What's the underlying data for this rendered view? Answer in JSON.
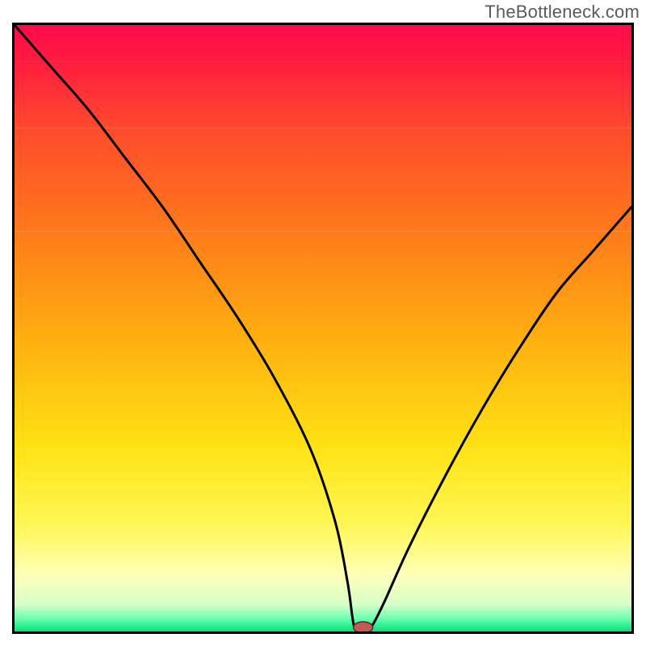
{
  "watermark": "TheBottleneck.com",
  "chart_data": {
    "type": "line",
    "title": "",
    "xlabel": "",
    "ylabel": "",
    "xlim": [
      0,
      100
    ],
    "ylim": [
      0,
      100
    ],
    "x": [
      0,
      6,
      12,
      18,
      24,
      30,
      36,
      42,
      48,
      52,
      54,
      55,
      56,
      57,
      58,
      60,
      64,
      70,
      76,
      82,
      88,
      94,
      100
    ],
    "values": [
      100,
      93,
      86,
      78,
      70,
      61,
      52,
      42,
      30,
      18,
      8,
      1,
      0,
      0,
      1,
      5,
      14,
      26,
      37,
      47,
      56,
      63,
      70
    ],
    "marker": {
      "x": 56.5,
      "y": 0
    },
    "gradient_bands": [
      {
        "y0": 0.0,
        "y1": 0.06,
        "from": "#ff0a4a",
        "to": "#ff1c3f"
      },
      {
        "y0": 0.06,
        "y1": 0.17,
        "from": "#ff1c3f",
        "to": "#ff4a2d"
      },
      {
        "y0": 0.17,
        "y1": 0.34,
        "from": "#ff4a2d",
        "to": "#ff7a1a"
      },
      {
        "y0": 0.34,
        "y1": 0.52,
        "from": "#ff7a1a",
        "to": "#ffb010"
      },
      {
        "y0": 0.52,
        "y1": 0.7,
        "from": "#ffb010",
        "to": "#ffe314"
      },
      {
        "y0": 0.7,
        "y1": 0.83,
        "from": "#ffe314",
        "to": "#fff85a"
      },
      {
        "y0": 0.83,
        "y1": 0.905,
        "from": "#fff85a",
        "to": "#ffffb8"
      },
      {
        "y0": 0.905,
        "y1": 0.955,
        "from": "#ffffb8",
        "to": "#d8ffc8"
      },
      {
        "y0": 0.955,
        "y1": 0.978,
        "from": "#d8ffc8",
        "to": "#6fffb0"
      },
      {
        "y0": 0.978,
        "y1": 1.0,
        "from": "#6fffb0",
        "to": "#00e27a"
      }
    ],
    "colors": {
      "curve": "#000000",
      "marker_fill": "#c25a58",
      "marker_stroke": "#5a2a28"
    }
  }
}
